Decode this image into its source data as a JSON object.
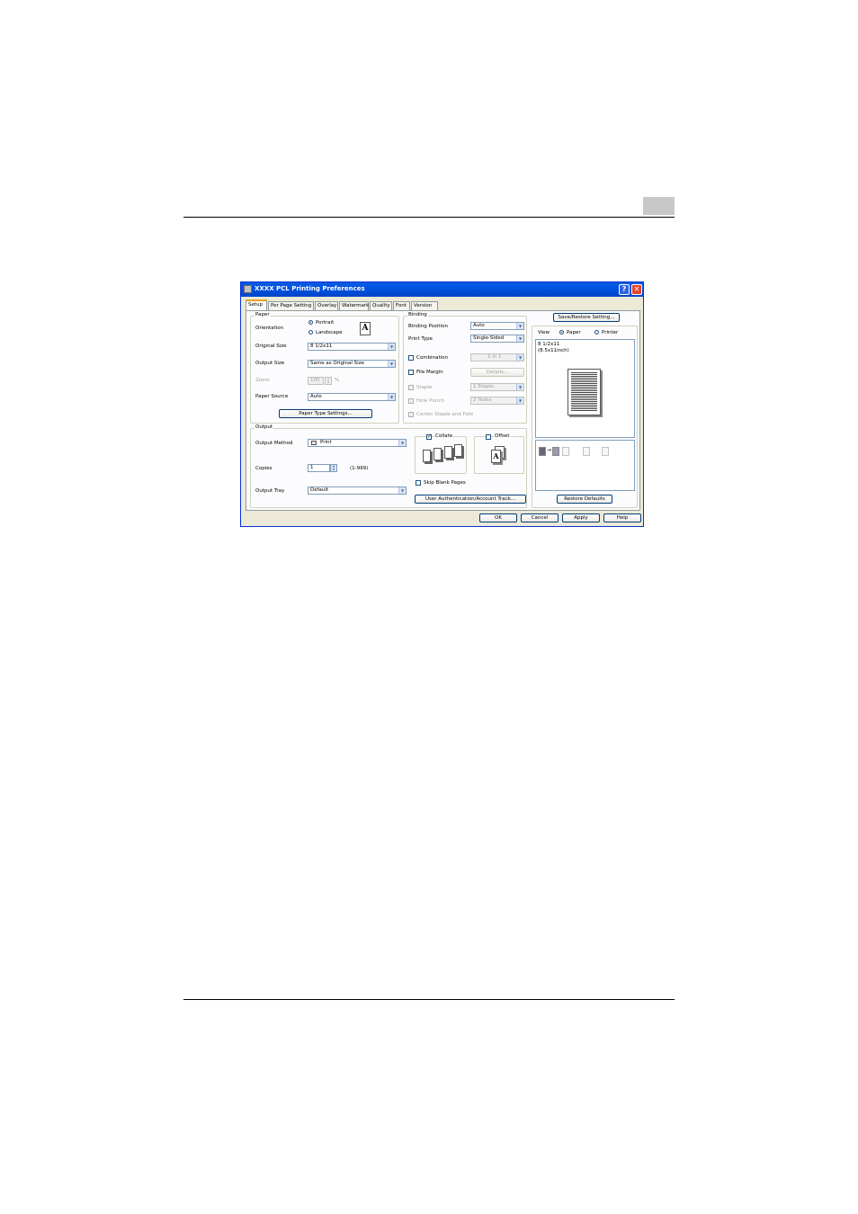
{
  "window": {
    "title": "XXXX PCL Printing Preferences",
    "help_glyph": "?",
    "close_glyph": "✕"
  },
  "tabs": [
    "Setup",
    "Per Page Setting",
    "Overlay",
    "Watermark",
    "Quality",
    "Font",
    "Version"
  ],
  "paper": {
    "group_title": "Paper",
    "orientation_label": "Orientation",
    "portrait_label": "Portrait",
    "landscape_label": "Landscape",
    "orientation_icon": "A",
    "original_size_label": "Original Size",
    "original_size_value": "8 1/2x11",
    "output_size_label": "Output Size",
    "output_size_value": "Same as Original Size",
    "zoom_label": "Zoom",
    "zoom_value": "100",
    "zoom_unit": "%",
    "paper_source_label": "Paper Source",
    "paper_source_value": "Auto",
    "paper_type_button": "Paper Type Settings..."
  },
  "binding": {
    "group_title": "Binding",
    "binding_position_label": "Binding Position",
    "binding_position_value": "Auto",
    "print_type_label": "Print Type",
    "print_type_value": "Single-Sided",
    "combination_label": "Combination",
    "combination_value": "2 in 1",
    "file_margin_label": "File Margin",
    "details_button": "Details...",
    "staple_label": "Staple",
    "staple_value": "1 Staple",
    "hole_punch_label": "Hole Punch",
    "hole_punch_value": "2 Holes",
    "center_staple_label": "Center Staple and Fold"
  },
  "output": {
    "group_title": "Output",
    "output_method_label": "Output Method",
    "output_method_value": "Print",
    "copies_label": "Copies",
    "copies_value": "1",
    "copies_range": "(1-999)",
    "output_tray_label": "Output Tray",
    "output_tray_value": "Default",
    "collate_label": "Collate",
    "offset_label": "Offset",
    "skip_blank_label": "Skip Blank Pages",
    "user_auth_button": "User Authentication/Account Track..."
  },
  "right": {
    "save_restore_button": "Save/Restore Setting...",
    "view_label": "View",
    "paper_radio": "Paper",
    "printer_radio": "Printer",
    "preview_size": "8 1/2x11",
    "preview_size_inch": "(8.5x11inch)",
    "restore_defaults_button": "Restore Defaults"
  },
  "footer": {
    "ok": "OK",
    "cancel": "Cancel",
    "apply": "Apply",
    "help": "Help"
  }
}
